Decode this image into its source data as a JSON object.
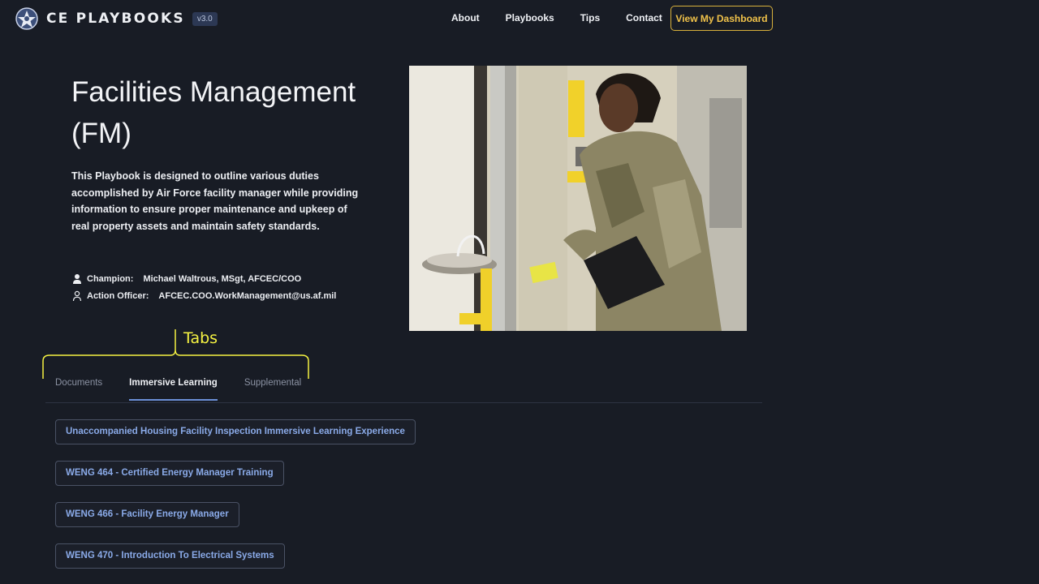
{
  "header": {
    "brand_name": "CE PLAYBOOKS",
    "version": "v3.0",
    "nav": [
      {
        "label": "About"
      },
      {
        "label": "Playbooks"
      },
      {
        "label": "Tips"
      },
      {
        "label": "Contact"
      }
    ],
    "dashboard_button": "View My Dashboard"
  },
  "hero": {
    "title": "Facilities Management (FM)",
    "description": "This Playbook is designed to outline various duties accomplished by Air Force facility manager while providing information to ensure proper maintenance and upkeep of real property assets and maintain safety standards.",
    "champion_label": "Champion:",
    "champion_value": "Michael Waltrous, MSgt, AFCEC/COO",
    "action_officer_label": "Action Officer:",
    "action_officer_value": "AFCEC.COO.WorkManagement@us.af.mil"
  },
  "annotation": {
    "label": "Tabs"
  },
  "tabs": [
    {
      "label": "Documents",
      "active": false
    },
    {
      "label": "Immersive Learning",
      "active": true
    },
    {
      "label": "Supplemental",
      "active": false
    }
  ],
  "links": [
    {
      "label": "Unaccompanied Housing Facility Inspection Immersive Learning Experience"
    },
    {
      "label": "WENG 464 - Certified Energy Manager Training"
    },
    {
      "label": "WENG 466 - Facility Energy Manager"
    },
    {
      "label": "WENG 470 - Introduction To Electrical Systems"
    }
  ],
  "colors": {
    "background": "#181c25",
    "accent_gold": "#d8b03c",
    "link_blue": "#8aaae8",
    "annotation_yellow": "#f5f242"
  }
}
